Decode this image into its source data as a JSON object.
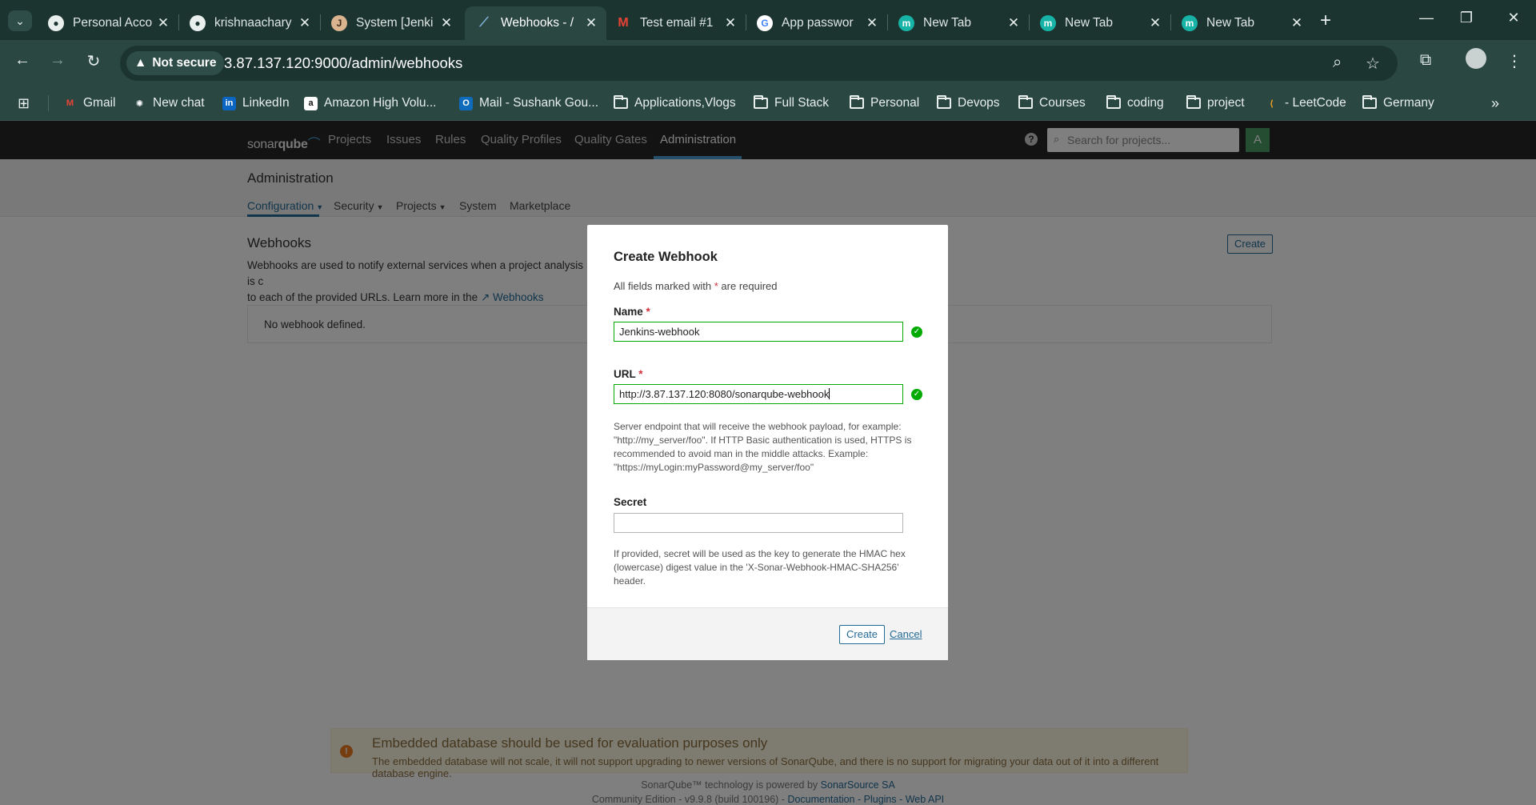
{
  "browser": {
    "tabs": [
      {
        "title": "Personal Acco",
        "favicon": "github-icon"
      },
      {
        "title": "krishnaachary",
        "favicon": "github-icon"
      },
      {
        "title": "System [Jenki",
        "favicon": "jenkins-icon"
      },
      {
        "title": "Webhooks - /",
        "favicon": "sonarqube-icon",
        "active": true
      },
      {
        "title": "Test email #1",
        "favicon": "gmail-icon"
      },
      {
        "title": "App passwor",
        "favicon": "google-icon"
      },
      {
        "title": "New Tab",
        "favicon": "m-icon"
      },
      {
        "title": "New Tab",
        "favicon": "m-icon"
      },
      {
        "title": "New Tab",
        "favicon": "m-icon"
      }
    ],
    "security_label": "Not secure",
    "url": "3.87.137.120:9000/admin/webhooks",
    "bookmarks": [
      {
        "label": "Gmail"
      },
      {
        "label": "New chat"
      },
      {
        "label": "LinkedIn"
      },
      {
        "label": "Amazon High Volu..."
      },
      {
        "label": "Mail - Sushank Gou..."
      },
      {
        "label": "Applications,Vlogs"
      },
      {
        "label": "Full Stack"
      },
      {
        "label": "Personal"
      },
      {
        "label": "Devops"
      },
      {
        "label": "Courses"
      },
      {
        "label": "coding"
      },
      {
        "label": "project"
      },
      {
        "label": "- LeetCode"
      },
      {
        "label": "Germany"
      }
    ]
  },
  "sonar": {
    "logo_a": "sonar",
    "logo_b": "qube",
    "menu": [
      "Projects",
      "Issues",
      "Rules",
      "Quality Profiles",
      "Quality Gates",
      "Administration"
    ],
    "search_placeholder": "Search for projects...",
    "avatar_letter": "A",
    "accent": "#236a97",
    "nav_bg": "#262626"
  },
  "admin": {
    "title": "Administration",
    "tabs": [
      "Configuration",
      "Security",
      "Projects",
      "System",
      "Marketplace"
    ]
  },
  "webhooks": {
    "title": "Webhooks",
    "desc_line1": "Webhooks are used to notify external services when a project analysis is c",
    "desc_line2": "to each of the provided URLs. Learn more in the",
    "desc_link": "Webhooks documenta",
    "create_button": "Create",
    "empty_text": "No webhook defined."
  },
  "modal": {
    "title": "Create Webhook",
    "hint_pre": "All fields marked with",
    "hint_star": "*",
    "hint_post": "are required",
    "name_label": "Name",
    "name_value": "Jenkins-webhook",
    "url_label": "URL",
    "url_value": "http://3.87.137.120:8080/sonarqube-webhook",
    "url_help": "Server endpoint that will receive the webhook payload, for example: \"http://my_server/foo\". If HTTP Basic authentication is used, HTTPS is recommended to avoid man in the middle attacks. Example: \"https://myLogin:myPassword@my_server/foo\"",
    "secret_label": "Secret",
    "secret_value": "",
    "secret_help": "If provided, secret will be used as the key to generate the HMAC hex (lowercase) digest value in the 'X-Sonar-Webhook-HMAC-SHA256' header.",
    "create_button": "Create",
    "cancel_link": "Cancel",
    "valid_color": "#00aa00"
  },
  "footer": {
    "warn_title": "Embedded database should be used for evaluation purposes only",
    "warn_text": "The embedded database will not scale, it will not support upgrading to newer versions of SonarQube, and there is no support for migrating your data out of it into a different database engine.",
    "line1_pre": "SonarQube™ technology is powered by",
    "line1_link": "SonarSource SA",
    "line2_pre": "Community Edition - v9.9.8 (build 100196) -",
    "line2_links": "Documentation - Plugins - Web API"
  }
}
